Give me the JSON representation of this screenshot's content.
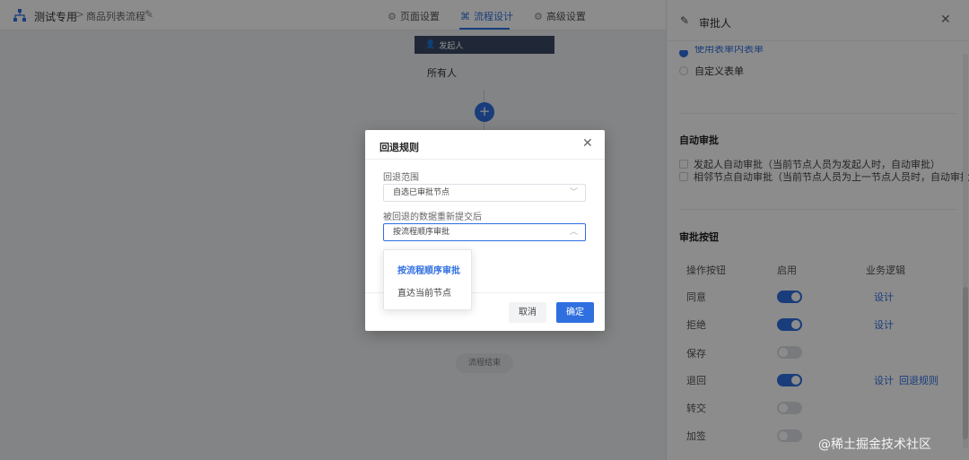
{
  "header": {
    "breadcrumb_home": "测试专用",
    "breadcrumb_sep": ">",
    "breadcrumb_current": "商品列表流程",
    "tabs": [
      {
        "label": "页面设置",
        "icon": "gear-icon"
      },
      {
        "label": "流程设计",
        "icon": "flow-icon",
        "active": true
      },
      {
        "label": "高级设置",
        "icon": "settings-icon"
      }
    ]
  },
  "flow": {
    "start_node_label": "发起人",
    "start_node_body": "所有人",
    "add_symbol": "+",
    "end_node_label": "流程结束"
  },
  "panel": {
    "title": "审批人",
    "clipped_radio_label": "使用表单内表单",
    "custom_form_label": "自定义表单",
    "auto_approve": {
      "title": "自动审批",
      "options": [
        "发起人自动审批（当前节点人员为发起人时，自动审批）",
        "相邻节点自动审批（当前节点人员为上一节点人员时，自动审批）"
      ]
    },
    "buttons": {
      "title": "审批按钮",
      "col_action": "操作按钮",
      "col_enabled": "启用",
      "col_logic": "业务逻辑",
      "rows": [
        {
          "label": "同意",
          "enabled": true,
          "links": [
            "设计"
          ]
        },
        {
          "label": "拒绝",
          "enabled": true,
          "links": [
            "设计"
          ]
        },
        {
          "label": "保存",
          "enabled": false,
          "links": []
        },
        {
          "label": "退回",
          "enabled": true,
          "links": [
            "设计",
            "回退规则"
          ]
        },
        {
          "label": "转交",
          "enabled": false,
          "links": []
        },
        {
          "label": "加签",
          "enabled": false,
          "links": []
        }
      ]
    }
  },
  "dialog": {
    "title": "回退规则",
    "field1_label": "回退范围",
    "field1_value": "自选已审批节点",
    "field2_label": "被回退的数据重新提交后",
    "field2_value": "按流程顺序审批",
    "dropdown_options": [
      "按流程顺序审批",
      "直达当前节点"
    ],
    "dropdown_selected": "按流程顺序审批",
    "cancel_label": "取消",
    "ok_label": "确定"
  },
  "watermark": "@稀土掘金技术社区",
  "colors": {
    "accent": "#2f6fe0",
    "node_dark": "#3b4a66"
  }
}
